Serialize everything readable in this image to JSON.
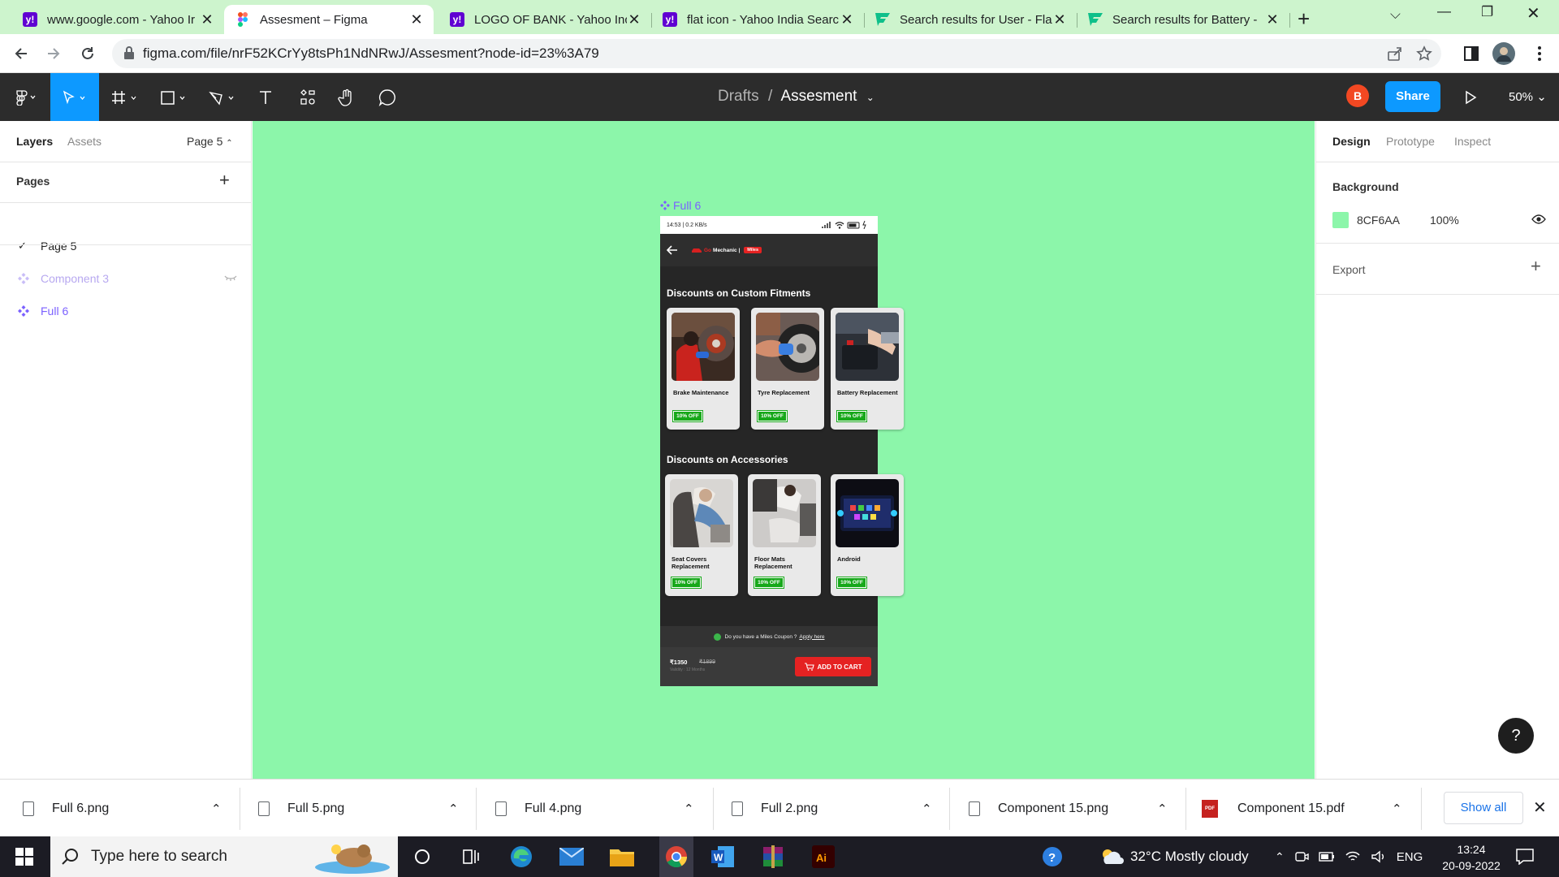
{
  "browser": {
    "tabs": [
      {
        "title": "www.google.com - Yahoo Ir",
        "fav": "yahoo",
        "active": false
      },
      {
        "title": "Assesment – Figma",
        "fav": "figma",
        "active": true
      },
      {
        "title": "LOGO OF BANK - Yahoo Inc",
        "fav": "yahoo",
        "active": false
      },
      {
        "title": "flat icon - Yahoo India Searc",
        "fav": "yahoo",
        "active": false
      },
      {
        "title": "Search results for User - Fla",
        "fav": "flaticon",
        "active": false
      },
      {
        "title": "Search results for Battery - ",
        "fav": "flaticon",
        "active": false
      }
    ],
    "url": "figma.com/file/nrF52KCrYy8tsPh1NdNRwJ/Assesment?node-id=23%3A79"
  },
  "figma": {
    "breadcrumb_parent": "Drafts",
    "breadcrumb_sep": "/",
    "file_name": "Assesment",
    "avatar_initial": "B",
    "share_label": "Share",
    "zoom": "50%",
    "left_tabs": {
      "layers": "Layers",
      "assets": "Assets"
    },
    "page_selector": "Page 5",
    "pages_header": "Pages",
    "pages": [
      {
        "label": "Page 5",
        "checked": true
      }
    ],
    "layers": [
      {
        "label": "Component 3",
        "type": "component",
        "hidden": true
      },
      {
        "label": "Full 6",
        "type": "component",
        "hidden": false
      }
    ],
    "right_tabs": {
      "design": "Design",
      "prototype": "Prototype",
      "inspect": "Inspect"
    },
    "background_label": "Background",
    "background_hex": "8CF6AA",
    "background_opacity": "100%",
    "export_label": "Export",
    "canvas_color": "#8CF6AA"
  },
  "frame": {
    "label": "Full 6",
    "status_time": "14:53 | 0.2 KB/s",
    "brand_go": "Go",
    "brand_mechanic": "Mechanic |",
    "brand_miles": "Miles",
    "section1_title": "Discounts on Custom Fitments",
    "section1_cards": [
      {
        "name": "Brake Maintenance",
        "offer": "10% OFF"
      },
      {
        "name": "Tyre Replacement",
        "offer": "10% OFF"
      },
      {
        "name": "Battery Replacement",
        "offer": "10% OFF"
      }
    ],
    "section2_title": "Discounts on Accessories",
    "section2_cards": [
      {
        "name": "Seat Covers Replacement",
        "offer": "10% OFF"
      },
      {
        "name": "Floor  Mats Replacement",
        "offer": "10% OFF"
      },
      {
        "name": "Android",
        "offer": "10% OFF"
      }
    ],
    "coupon_text": "Do you have a Miles Coupon ?",
    "coupon_link": "Apply here",
    "price": "₹1350",
    "old_price": "₹1899",
    "validity": "Validity : 12 Months",
    "cart_label": "ADD TO CART"
  },
  "downloads": {
    "items": [
      "Full 6.png",
      "Full 5.png",
      "Full 4.png",
      "Full 2.png",
      "Component 15.png",
      "Component 15.pdf"
    ],
    "show_all": "Show all"
  },
  "taskbar": {
    "search_placeholder": "Type here to search",
    "weather": "32°C  Mostly cloudy",
    "lang": "ENG",
    "time": "13:24",
    "date": "20-09-2022"
  }
}
